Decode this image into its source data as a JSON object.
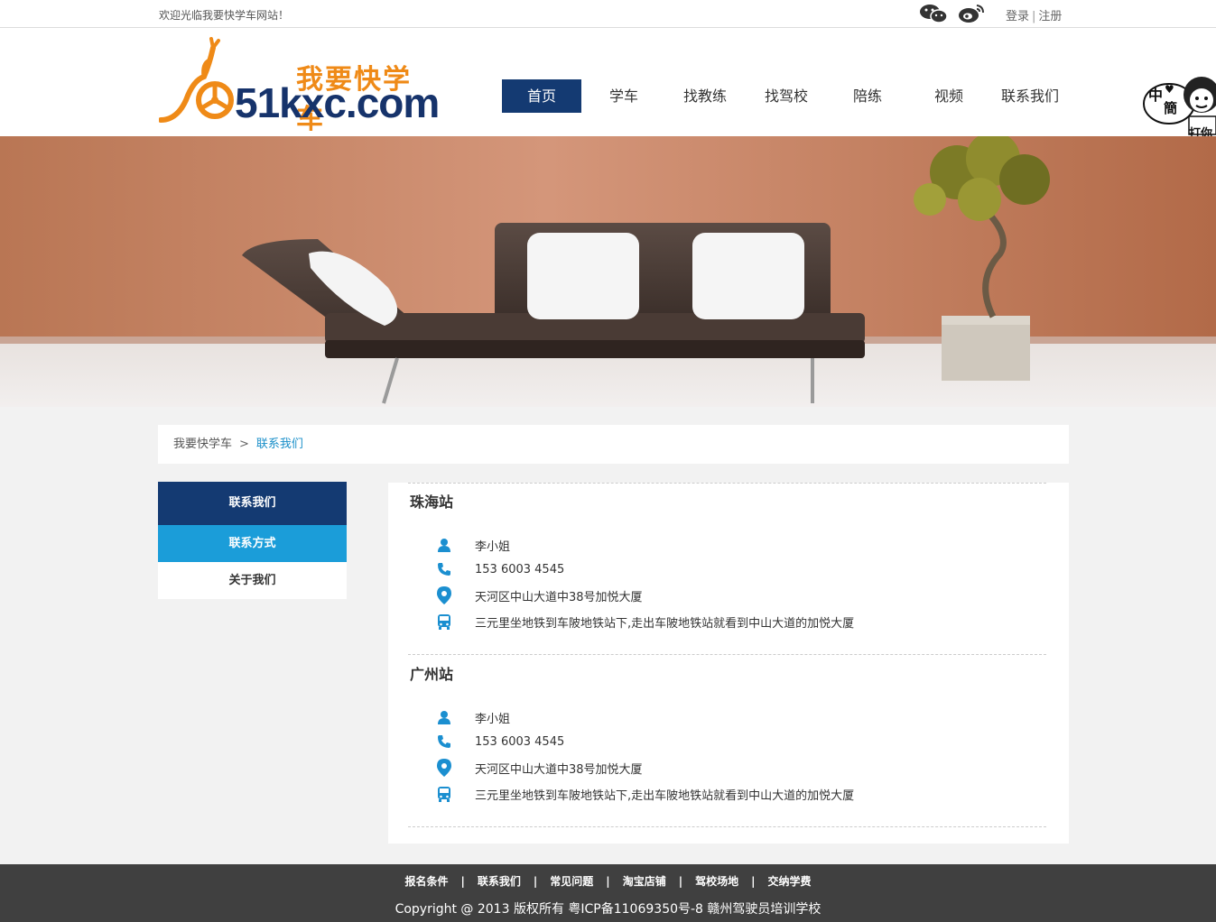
{
  "topbar": {
    "welcome": "欢迎光临我要快学车网站！",
    "login": "登录",
    "separator": "|",
    "register": "注册",
    "icons": [
      "wechat-icon",
      "weibo-icon"
    ]
  },
  "logo": {
    "cn": "我要快学车",
    "en": "51kxc.com",
    "colors": {
      "orange": "#ef8a17",
      "navy": "#16336b"
    }
  },
  "nav": {
    "items": [
      {
        "label": "首页",
        "active": true
      },
      {
        "label": "学车"
      },
      {
        "label": "找教练"
      },
      {
        "label": "找驾校"
      },
      {
        "label": "陪练"
      },
      {
        "label": "视频"
      },
      {
        "label": "联系我们"
      }
    ]
  },
  "mascot": {
    "line1": "中",
    "line2": "簡",
    "line3": "打你"
  },
  "breadcrumb": {
    "home": "我要快学车",
    "sep": ">",
    "current": "联系我们"
  },
  "sidebar": {
    "title": "联系我们",
    "items": [
      {
        "label": "联系方式",
        "active": true
      },
      {
        "label": "关于我们"
      }
    ]
  },
  "stations": [
    {
      "name": "珠海站",
      "contact": "李小姐",
      "phone": "153 6003 4545",
      "address": "天河区中山大道中38号加悦大厦",
      "transit": "三元里坐地铁到车陂地铁站下,走出车陂地铁站就看到中山大道的加悦大厦"
    },
    {
      "name": "广州站",
      "contact": "李小姐",
      "phone": "153 6003 4545",
      "address": "天河区中山大道中38号加悦大厦",
      "transit": "三元里坐地铁到车陂地铁站下,走出车陂地铁站就看到中山大道的加悦大厦"
    }
  ],
  "footer": {
    "links": [
      "报名条件",
      "联系我们",
      "常见问题",
      "淘宝店铺",
      "驾校场地",
      "交纳学费"
    ],
    "sep": "|",
    "copyright": "Copyright @ 2013 版权所有 粤ICP备11069350号-8   赣州驾驶员培训学校"
  },
  "colors": {
    "nav_active": "#143a72",
    "sidebar_active": "#1b9dd9",
    "accent_icon": "#1b8fd0",
    "footer_bg": "#404040"
  }
}
